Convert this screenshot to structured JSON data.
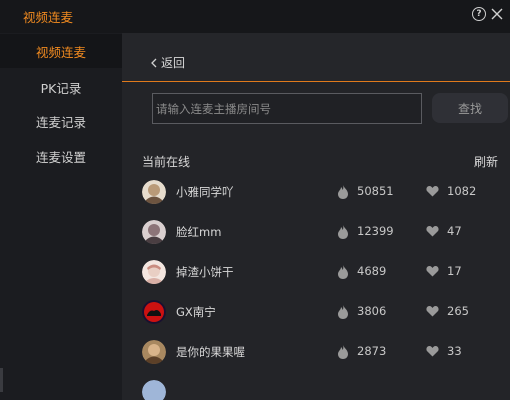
{
  "window": {
    "title": "视频连麦",
    "help_icon": "question-circle-icon",
    "close_icon": "close-icon"
  },
  "sidebar": {
    "items": [
      {
        "label": "视频连麦",
        "active": true
      },
      {
        "label": "PK记录",
        "active": false
      },
      {
        "label": "连麦记录",
        "active": false
      },
      {
        "label": "连麦设置",
        "active": false
      }
    ]
  },
  "main": {
    "back_label": "返回",
    "search": {
      "placeholder": "请输入连麦主播房间号",
      "value": "",
      "button_label": "查找"
    },
    "online_label": "当前在线",
    "refresh_label": "刷新",
    "users": [
      {
        "name": "小雅同学吖",
        "heat": "50851",
        "likes": "1082",
        "avatar_color": "#c9b59a"
      },
      {
        "name": "脸红mm",
        "heat": "12399",
        "likes": "47",
        "avatar_color": "#b8aab0"
      },
      {
        "name": "掉渣小饼干",
        "heat": "4689",
        "likes": "17",
        "avatar_color": "#e8d4cc"
      },
      {
        "name": "GX南宁",
        "heat": "3806",
        "likes": "265",
        "avatar_color": "#cc1111"
      },
      {
        "name": "是你的果果喔",
        "heat": "2873",
        "likes": "33",
        "avatar_color": "#8a6a4c"
      }
    ]
  },
  "colors": {
    "accent": "#f08a20",
    "background": "#1b1c20",
    "panel": "#232428"
  }
}
